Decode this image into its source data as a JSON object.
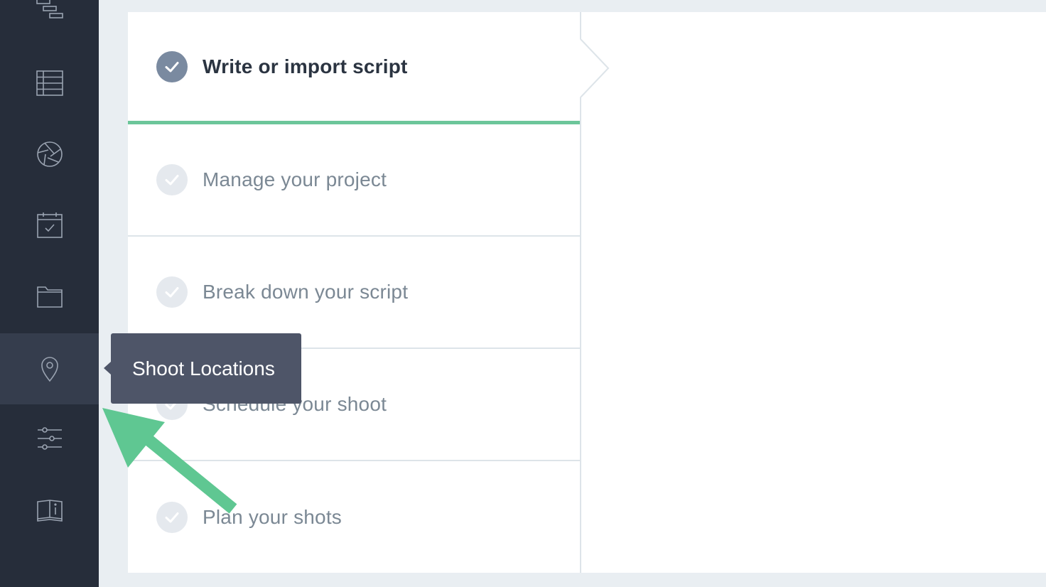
{
  "sidebar": {
    "items": [
      {
        "name": "gantt-icon"
      },
      {
        "name": "stripboard-icon"
      },
      {
        "name": "aperture-icon"
      },
      {
        "name": "calendar-check-icon"
      },
      {
        "name": "folder-icon"
      },
      {
        "name": "location-pin-icon",
        "active": true
      },
      {
        "name": "sliders-icon"
      },
      {
        "name": "book-info-icon"
      }
    ]
  },
  "tooltip": {
    "text": "Shoot Locations"
  },
  "steps": [
    {
      "label": "Write or import script",
      "active": true
    },
    {
      "label": "Manage your project"
    },
    {
      "label": "Break down your script"
    },
    {
      "label": "Schedule your shoot"
    },
    {
      "label": "Plan your shots"
    }
  ],
  "colors": {
    "sidebar_bg": "#262d3a",
    "sidebar_active": "#353d4d",
    "accent_green": "#6cc69a",
    "active_check": "#7a8aa0",
    "tooltip_bg": "#4e5568"
  }
}
